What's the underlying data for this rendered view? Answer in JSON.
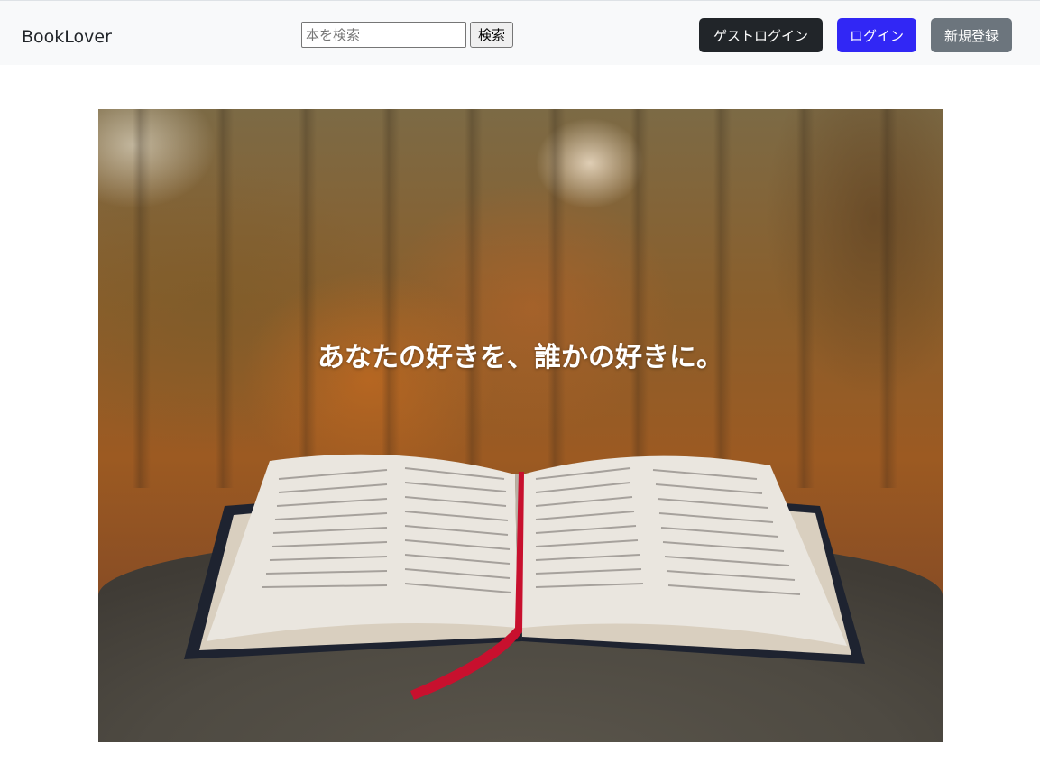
{
  "navbar": {
    "brand": "BookLover",
    "search": {
      "placeholder": "本を検索",
      "value": "",
      "button_label": "検索"
    },
    "guest_login_label": "ゲストログイン",
    "login_label": "ログイン",
    "register_label": "新規登録"
  },
  "hero": {
    "tagline": "あなたの好きを、誰かの好きに。"
  },
  "colors": {
    "navbar_bg": "#f8f9fa",
    "guest_button": "#212529",
    "login_button": "#3127f5",
    "register_button": "#6c757d"
  }
}
